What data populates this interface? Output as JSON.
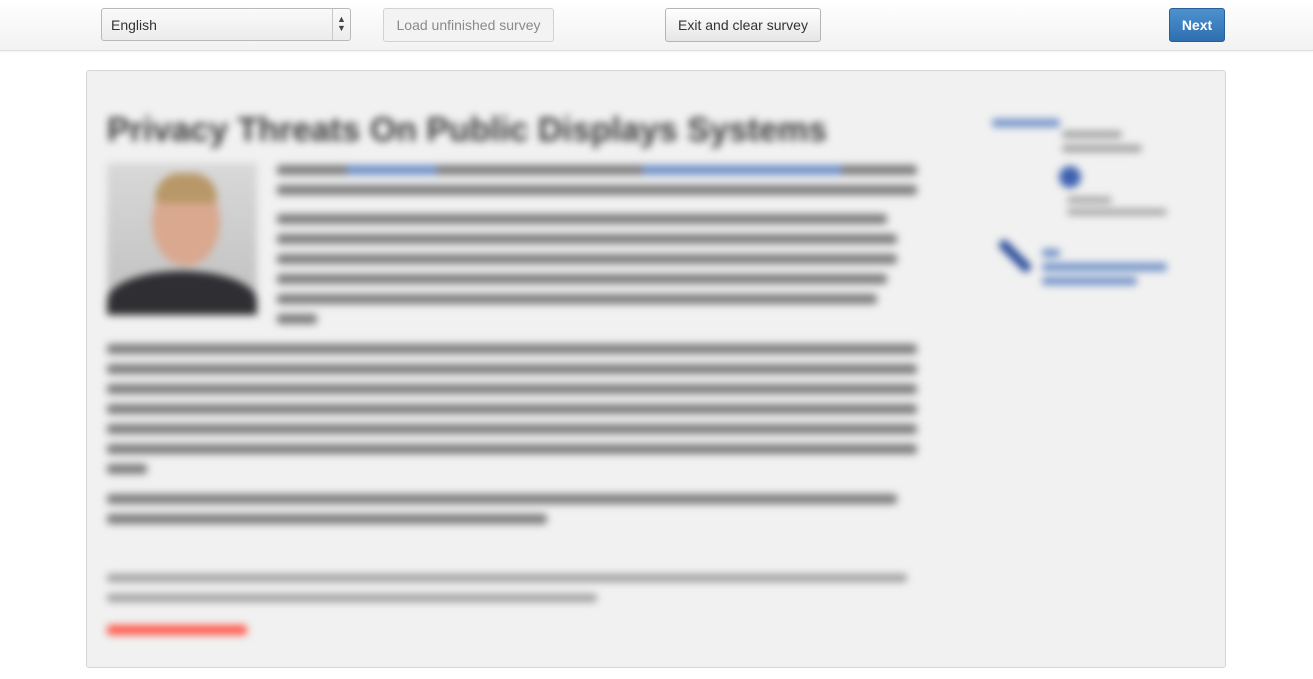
{
  "toolbar": {
    "language_value": "English",
    "language_select_icon": "updown-arrows-icon",
    "load_label": "Load unfinished survey",
    "exit_label": "Exit and clear survey",
    "next_label": "Next"
  },
  "content": {
    "title": "Privacy Threats On Public Displays Systems"
  },
  "colors": {
    "next_button": "#337ab7",
    "link": "#6e8fc7",
    "notice": "#ff5a4d"
  }
}
